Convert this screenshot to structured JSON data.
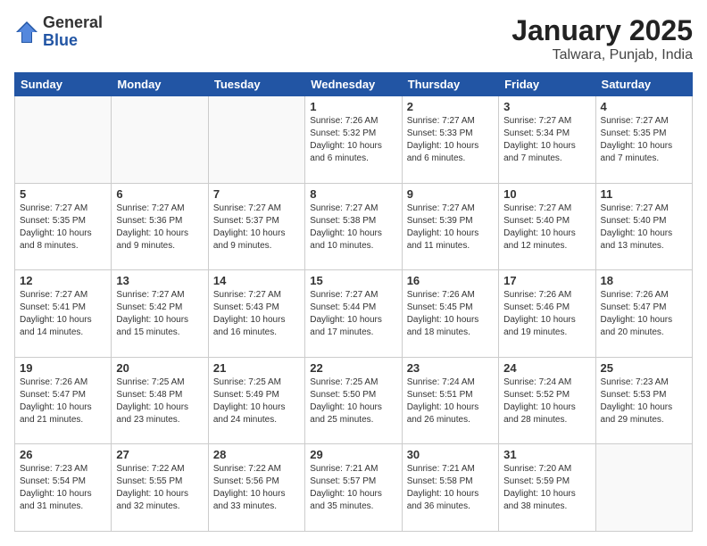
{
  "logo": {
    "general": "General",
    "blue": "Blue"
  },
  "header": {
    "title": "January 2025",
    "subtitle": "Talwara, Punjab, India"
  },
  "weekdays": [
    "Sunday",
    "Monday",
    "Tuesday",
    "Wednesday",
    "Thursday",
    "Friday",
    "Saturday"
  ],
  "weeks": [
    [
      {
        "day": "",
        "info": ""
      },
      {
        "day": "",
        "info": ""
      },
      {
        "day": "",
        "info": ""
      },
      {
        "day": "1",
        "info": "Sunrise: 7:26 AM\nSunset: 5:32 PM\nDaylight: 10 hours\nand 6 minutes."
      },
      {
        "day": "2",
        "info": "Sunrise: 7:27 AM\nSunset: 5:33 PM\nDaylight: 10 hours\nand 6 minutes."
      },
      {
        "day": "3",
        "info": "Sunrise: 7:27 AM\nSunset: 5:34 PM\nDaylight: 10 hours\nand 7 minutes."
      },
      {
        "day": "4",
        "info": "Sunrise: 7:27 AM\nSunset: 5:35 PM\nDaylight: 10 hours\nand 7 minutes."
      }
    ],
    [
      {
        "day": "5",
        "info": "Sunrise: 7:27 AM\nSunset: 5:35 PM\nDaylight: 10 hours\nand 8 minutes."
      },
      {
        "day": "6",
        "info": "Sunrise: 7:27 AM\nSunset: 5:36 PM\nDaylight: 10 hours\nand 9 minutes."
      },
      {
        "day": "7",
        "info": "Sunrise: 7:27 AM\nSunset: 5:37 PM\nDaylight: 10 hours\nand 9 minutes."
      },
      {
        "day": "8",
        "info": "Sunrise: 7:27 AM\nSunset: 5:38 PM\nDaylight: 10 hours\nand 10 minutes."
      },
      {
        "day": "9",
        "info": "Sunrise: 7:27 AM\nSunset: 5:39 PM\nDaylight: 10 hours\nand 11 minutes."
      },
      {
        "day": "10",
        "info": "Sunrise: 7:27 AM\nSunset: 5:40 PM\nDaylight: 10 hours\nand 12 minutes."
      },
      {
        "day": "11",
        "info": "Sunrise: 7:27 AM\nSunset: 5:40 PM\nDaylight: 10 hours\nand 13 minutes."
      }
    ],
    [
      {
        "day": "12",
        "info": "Sunrise: 7:27 AM\nSunset: 5:41 PM\nDaylight: 10 hours\nand 14 minutes."
      },
      {
        "day": "13",
        "info": "Sunrise: 7:27 AM\nSunset: 5:42 PM\nDaylight: 10 hours\nand 15 minutes."
      },
      {
        "day": "14",
        "info": "Sunrise: 7:27 AM\nSunset: 5:43 PM\nDaylight: 10 hours\nand 16 minutes."
      },
      {
        "day": "15",
        "info": "Sunrise: 7:27 AM\nSunset: 5:44 PM\nDaylight: 10 hours\nand 17 minutes."
      },
      {
        "day": "16",
        "info": "Sunrise: 7:26 AM\nSunset: 5:45 PM\nDaylight: 10 hours\nand 18 minutes."
      },
      {
        "day": "17",
        "info": "Sunrise: 7:26 AM\nSunset: 5:46 PM\nDaylight: 10 hours\nand 19 minutes."
      },
      {
        "day": "18",
        "info": "Sunrise: 7:26 AM\nSunset: 5:47 PM\nDaylight: 10 hours\nand 20 minutes."
      }
    ],
    [
      {
        "day": "19",
        "info": "Sunrise: 7:26 AM\nSunset: 5:47 PM\nDaylight: 10 hours\nand 21 minutes."
      },
      {
        "day": "20",
        "info": "Sunrise: 7:25 AM\nSunset: 5:48 PM\nDaylight: 10 hours\nand 23 minutes."
      },
      {
        "day": "21",
        "info": "Sunrise: 7:25 AM\nSunset: 5:49 PM\nDaylight: 10 hours\nand 24 minutes."
      },
      {
        "day": "22",
        "info": "Sunrise: 7:25 AM\nSunset: 5:50 PM\nDaylight: 10 hours\nand 25 minutes."
      },
      {
        "day": "23",
        "info": "Sunrise: 7:24 AM\nSunset: 5:51 PM\nDaylight: 10 hours\nand 26 minutes."
      },
      {
        "day": "24",
        "info": "Sunrise: 7:24 AM\nSunset: 5:52 PM\nDaylight: 10 hours\nand 28 minutes."
      },
      {
        "day": "25",
        "info": "Sunrise: 7:23 AM\nSunset: 5:53 PM\nDaylight: 10 hours\nand 29 minutes."
      }
    ],
    [
      {
        "day": "26",
        "info": "Sunrise: 7:23 AM\nSunset: 5:54 PM\nDaylight: 10 hours\nand 31 minutes."
      },
      {
        "day": "27",
        "info": "Sunrise: 7:22 AM\nSunset: 5:55 PM\nDaylight: 10 hours\nand 32 minutes."
      },
      {
        "day": "28",
        "info": "Sunrise: 7:22 AM\nSunset: 5:56 PM\nDaylight: 10 hours\nand 33 minutes."
      },
      {
        "day": "29",
        "info": "Sunrise: 7:21 AM\nSunset: 5:57 PM\nDaylight: 10 hours\nand 35 minutes."
      },
      {
        "day": "30",
        "info": "Sunrise: 7:21 AM\nSunset: 5:58 PM\nDaylight: 10 hours\nand 36 minutes."
      },
      {
        "day": "31",
        "info": "Sunrise: 7:20 AM\nSunset: 5:59 PM\nDaylight: 10 hours\nand 38 minutes."
      },
      {
        "day": "",
        "info": ""
      }
    ]
  ]
}
